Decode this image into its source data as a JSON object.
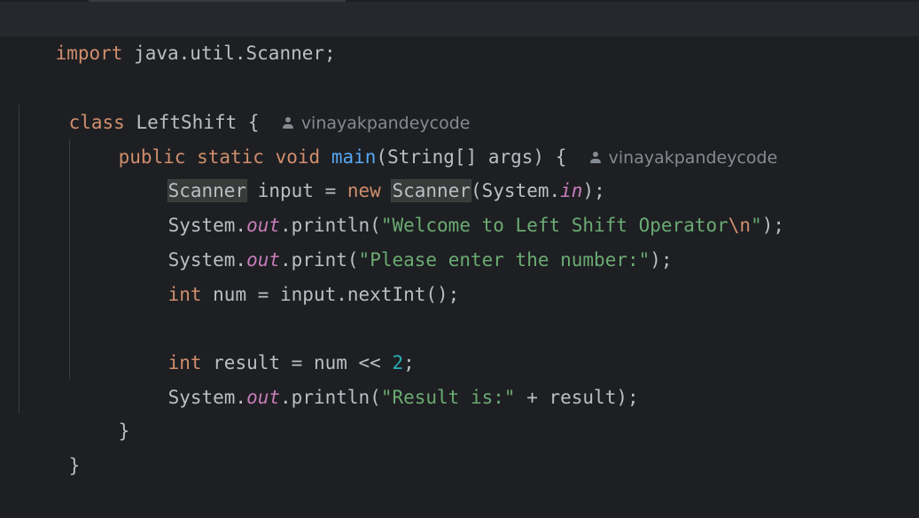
{
  "code": {
    "line1": {
      "kw_import": "import",
      "rest": " java.util.Scanner;"
    },
    "line3": {
      "kw_class": "class",
      "rest": " LeftShift {  "
    },
    "line4": {
      "kw_public": "public",
      "kw_static": "static",
      "kw_void": "void",
      "method": "main",
      "rest": "(String[] args) {  "
    },
    "line5": {
      "type1": "Scanner",
      "mid": " input = ",
      "kw_new": "new",
      "type2": "Scanner",
      "pre_field": "(System.",
      "field": "in",
      "end": ");"
    },
    "line6": {
      "pre": "System.",
      "field": "out",
      "call": ".println(",
      "str": "\"Welcome to Left Shift Operator",
      "esc": "\\n",
      "str_end": "\"",
      "end": ");"
    },
    "line7": {
      "pre": "System.",
      "field": "out",
      "call": ".print(",
      "str": "\"Please enter the number:\"",
      "end": ");"
    },
    "line8": {
      "kw_int": "int",
      "rest": " num = input.nextInt();"
    },
    "line10": {
      "kw_int": "int",
      "mid": " result = num << ",
      "num": "2",
      "end": ";"
    },
    "line11": {
      "pre": "System.",
      "field": "out",
      "call": ".println(",
      "str": "\"Result is:\"",
      "end": " + result);"
    },
    "line12": {
      "brace": "}"
    },
    "line13": {
      "brace": "}"
    }
  },
  "inlay": {
    "author_class": "vinayakpandeycode",
    "author_method": "vinayakpandeycode",
    "icon": "user-icon"
  },
  "colors": {
    "background": "#1e1f22",
    "keyword": "#cf8e6d",
    "method": "#56a8f5",
    "string": "#6aab73",
    "number": "#2aacb8",
    "field": "#c77dbb",
    "text": "#bcbec4"
  }
}
